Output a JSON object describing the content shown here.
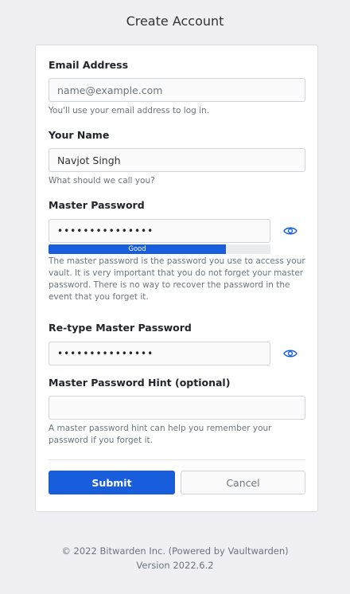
{
  "page": {
    "title": "Create Account"
  },
  "form": {
    "email": {
      "label": "Email Address",
      "placeholder": "name@example.com",
      "value": "",
      "help": "You'll use your email address to log in."
    },
    "name": {
      "label": "Your Name",
      "value": "Navjot Singh",
      "help": "What should we call you?"
    },
    "master_password": {
      "label": "Master Password",
      "value_masked": "•••••••••••••••",
      "strength_label": "Good",
      "strength_fraction": 0.8,
      "help": "The master password is the password you use to access your vault. It is very important that you do not forget your master password. There is no way to recover the password in the event that you forget it."
    },
    "retype_password": {
      "label": "Re-type Master Password",
      "value_masked": "•••••••••••••••"
    },
    "hint": {
      "label": "Master Password Hint (optional)",
      "value": "",
      "help": "A master password hint can help you remember your password if you forget it."
    },
    "submit_label": "Submit",
    "cancel_label": "Cancel"
  },
  "footer": {
    "copyright": "© 2022 Bitwarden Inc. (Powered by Vaultwarden)",
    "version": "Version 2022.6.2"
  },
  "icons": {
    "toggle_visibility": "eye-icon"
  },
  "colors": {
    "accent": "#175ddc",
    "background": "#efeff4",
    "card": "#ffffff",
    "muted_text": "#6c757d"
  }
}
